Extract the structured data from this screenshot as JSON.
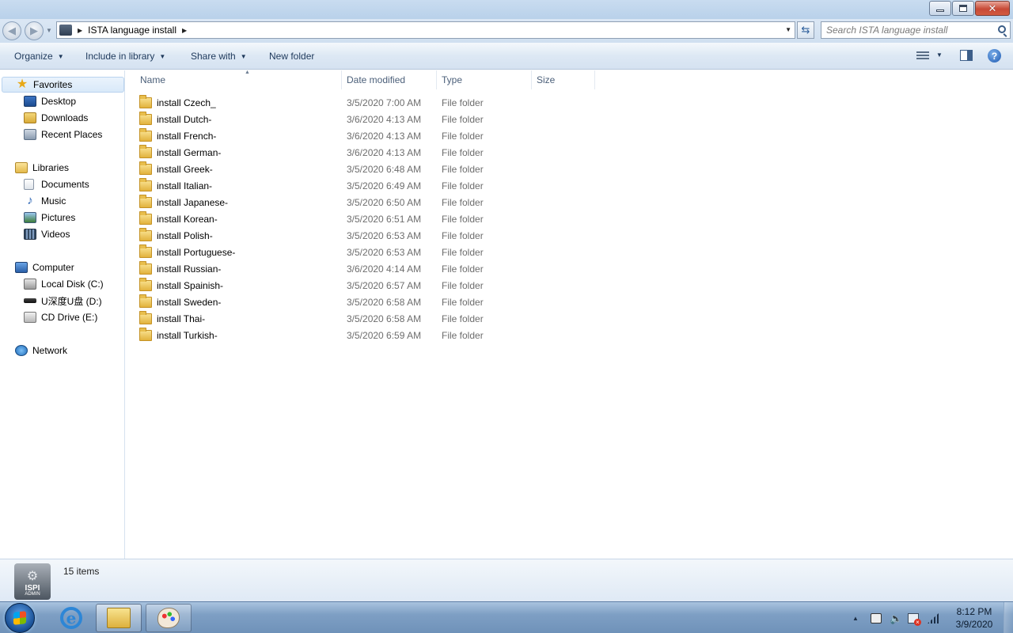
{
  "window": {
    "minimize_icon": "minimize-icon",
    "restore_icon": "restore-icon",
    "close_icon": "close-icon",
    "close_glyph": "✕"
  },
  "address": {
    "crumb": "ISTA language install",
    "search_placeholder": "Search ISTA language install"
  },
  "commandbar": {
    "organize": "Organize",
    "include_in_library": "Include in library",
    "share_with": "Share with",
    "new_folder": "New folder"
  },
  "nav": {
    "favorites": "Favorites",
    "desktop": "Desktop",
    "downloads": "Downloads",
    "recent_places": "Recent Places",
    "libraries": "Libraries",
    "documents": "Documents",
    "music": "Music",
    "pictures": "Pictures",
    "videos": "Videos",
    "computer": "Computer",
    "local_disk": "Local Disk (C:)",
    "usb_drive": "U深度U盘 (D:)",
    "cd_drive": "CD Drive (E:)",
    "network": "Network"
  },
  "columns": {
    "name": "Name",
    "date_modified": "Date modified",
    "type": "Type",
    "size": "Size"
  },
  "files": [
    {
      "name": "install Czech_",
      "date": "3/5/2020 7:00 AM",
      "type": "File folder"
    },
    {
      "name": "install Dutch-",
      "date": "3/6/2020 4:13 AM",
      "type": "File folder"
    },
    {
      "name": "install French-",
      "date": "3/6/2020 4:13 AM",
      "type": "File folder"
    },
    {
      "name": "install German-",
      "date": "3/6/2020 4:13 AM",
      "type": "File folder"
    },
    {
      "name": "install Greek-",
      "date": "3/5/2020 6:48 AM",
      "type": "File folder"
    },
    {
      "name": "install Italian-",
      "date": "3/5/2020 6:49 AM",
      "type": "File folder"
    },
    {
      "name": "install Japanese-",
      "date": "3/5/2020 6:50 AM",
      "type": "File folder"
    },
    {
      "name": "install Korean-",
      "date": "3/5/2020 6:51 AM",
      "type": "File folder"
    },
    {
      "name": "install Polish-",
      "date": "3/5/2020 6:53 AM",
      "type": "File folder"
    },
    {
      "name": "install Portuguese-",
      "date": "3/5/2020 6:53 AM",
      "type": "File folder"
    },
    {
      "name": "install Russian-",
      "date": "3/6/2020 4:14 AM",
      "type": "File folder"
    },
    {
      "name": "install Spainish-",
      "date": "3/5/2020 6:57 AM",
      "type": "File folder"
    },
    {
      "name": "install Sweden-",
      "date": "3/5/2020 6:58 AM",
      "type": "File folder"
    },
    {
      "name": "install Thai-",
      "date": "3/5/2020 6:58 AM",
      "type": "File folder"
    },
    {
      "name": "install Turkish-",
      "date": "3/5/2020 6:59 AM",
      "type": "File folder"
    }
  ],
  "details": {
    "count": "15 items",
    "app_icon_title": "ISPI",
    "app_icon_sub": "ADMIN"
  },
  "taskbar": {
    "time": "8:12 PM",
    "date": "3/9/2020",
    "ie_glyph": "e"
  }
}
